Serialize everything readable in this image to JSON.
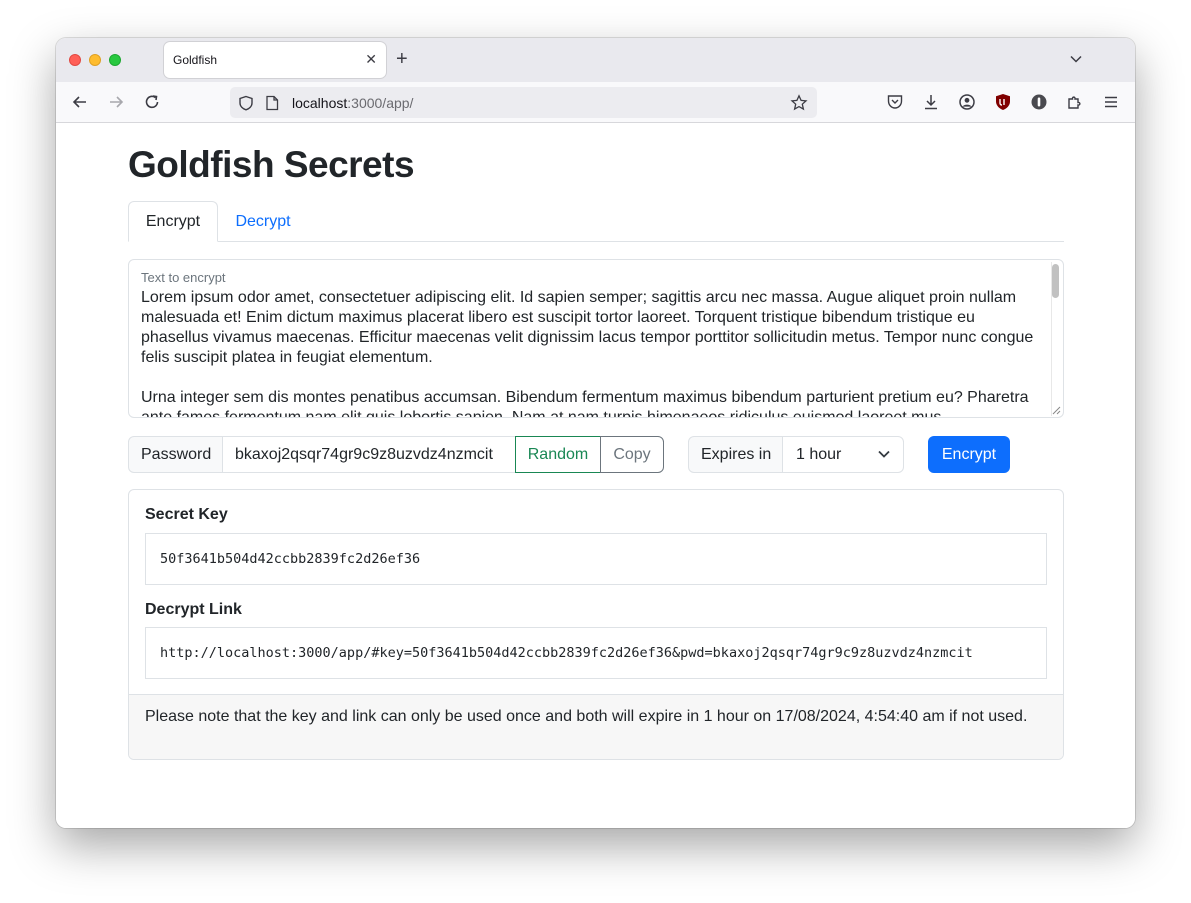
{
  "browser": {
    "tab_title": "Goldfish",
    "tab_close": "✕",
    "new_tab": "+",
    "url_host": "localhost",
    "url_path": ":3000/app/"
  },
  "page": {
    "title": "Goldfish Secrets",
    "tabs": [
      {
        "label": "Encrypt",
        "active": true
      },
      {
        "label": "Decrypt",
        "active": false
      }
    ]
  },
  "encrypt_form": {
    "text_label": "Text to encrypt",
    "text_paragraphs": [
      "Lorem ipsum odor amet, consectetuer adipiscing elit. Id sapien semper; sagittis arcu nec massa. Augue aliquet proin nullam malesuada et! Enim dictum maximus placerat libero est suscipit tortor laoreet. Torquent tristique bibendum tristique eu phasellus vivamus maecenas. Efficitur maecenas velit dignissim lacus tempor porttitor sollicitudin metus. Tempor nunc congue felis suscipit platea in feugiat elementum.",
      "Urna integer sem dis montes penatibus accumsan. Bibendum fermentum maximus bibendum parturient pretium eu? Pharetra ante fames fermentum nam elit quis lobortis sapien. Nam at nam turpis himenaeos ridiculus euismod laoreet mus."
    ],
    "password_label": "Password",
    "password_value": "bkaxoj2qsqr74gr9c9z8uzvdz4nzmcit",
    "random_button": "Random",
    "copy_button": "Copy",
    "expires_label": "Expires in",
    "expires_value": "1 hour",
    "encrypt_button": "Encrypt"
  },
  "result": {
    "secret_key_label": "Secret Key",
    "secret_key_value": "50f3641b504d42ccbb2839fc2d26ef36",
    "decrypt_link_label": "Decrypt Link",
    "decrypt_link_value": "http://localhost:3000/app/#key=50f3641b504d42ccbb2839fc2d26ef36&pwd=bkaxoj2qsqr74gr9c9z8uzvdz4nzmcit",
    "note": "Please note that the key and link can only be used once and both will expire in 1 hour on 17/08/2024, 4:54:40 am if not used."
  },
  "colors": {
    "primary": "#0d6efd",
    "success": "#198754",
    "secondary": "#6c757d"
  },
  "icons": [
    "back-arrow-icon",
    "forward-arrow-icon",
    "reload-icon",
    "shield-icon",
    "page-icon",
    "bookmark-star-icon",
    "pocket-icon",
    "download-icon",
    "account-icon",
    "ublock-icon",
    "password-manager-icon",
    "extensions-icon",
    "menu-icon",
    "chevron-down-icon"
  ]
}
